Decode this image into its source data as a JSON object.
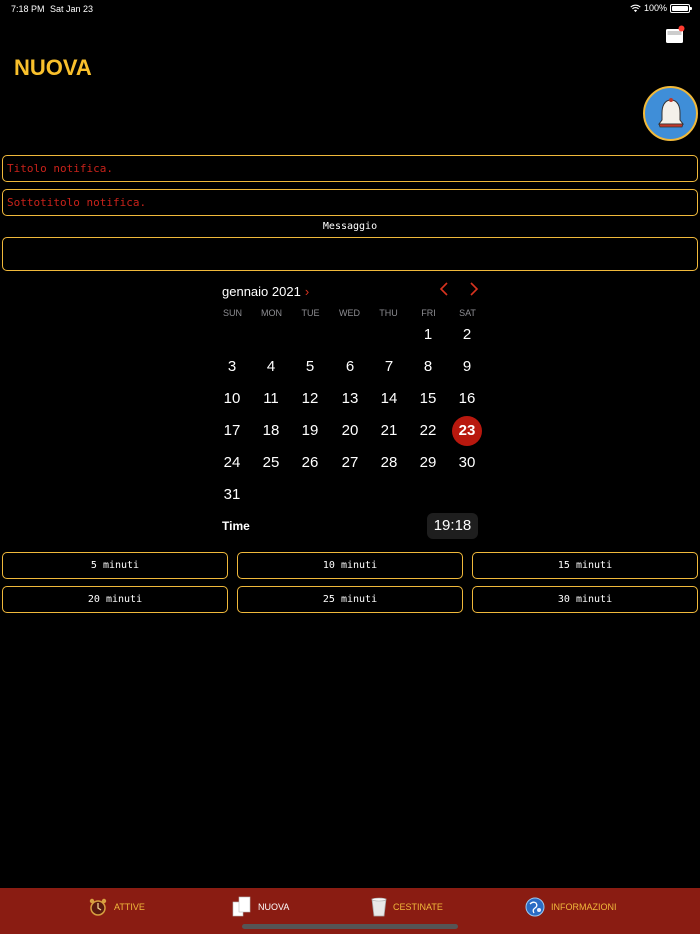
{
  "status_bar": {
    "time": "7:18 PM",
    "date": "Sat Jan 23",
    "battery": "100%"
  },
  "header": {
    "title": "NUOVA"
  },
  "form": {
    "title_placeholder": "Titolo notifica.",
    "subtitle_placeholder": "Sottotitolo notifica.",
    "message_label": "Messaggio",
    "message_value": ""
  },
  "calendar": {
    "month_year": "gennaio 2021",
    "weekdays": [
      "SUN",
      "MON",
      "TUE",
      "WED",
      "THU",
      "FRI",
      "SAT"
    ],
    "days": [
      "1",
      "2",
      "3",
      "4",
      "5",
      "6",
      "7",
      "8",
      "9",
      "10",
      "11",
      "12",
      "13",
      "14",
      "15",
      "16",
      "17",
      "18",
      "19",
      "20",
      "21",
      "22",
      "23",
      "24",
      "25",
      "26",
      "27",
      "28",
      "29",
      "30",
      "31"
    ],
    "selected_day": "23",
    "accent_color": "#b8180e"
  },
  "time": {
    "label": "Time",
    "value": "19:18"
  },
  "quick_buttons": [
    "5 minuti",
    "10 minuti",
    "15 minuti",
    "20 minuti",
    "25 minuti",
    "30 minuti"
  ],
  "tabs": [
    {
      "label": "ATTIVE",
      "icon": "alarm-clock-icon"
    },
    {
      "label": "NUOVA",
      "icon": "new-document-icon"
    },
    {
      "label": "CESTINATE",
      "icon": "trash-bin-icon"
    },
    {
      "label": "INFORMAZIONI",
      "icon": "info-globe-icon"
    }
  ],
  "colors": {
    "primary": "#f0b93b",
    "tab_bar": "#8a1c12",
    "placeholder": "#c8221a",
    "bell_button": "#3f8ed8"
  }
}
